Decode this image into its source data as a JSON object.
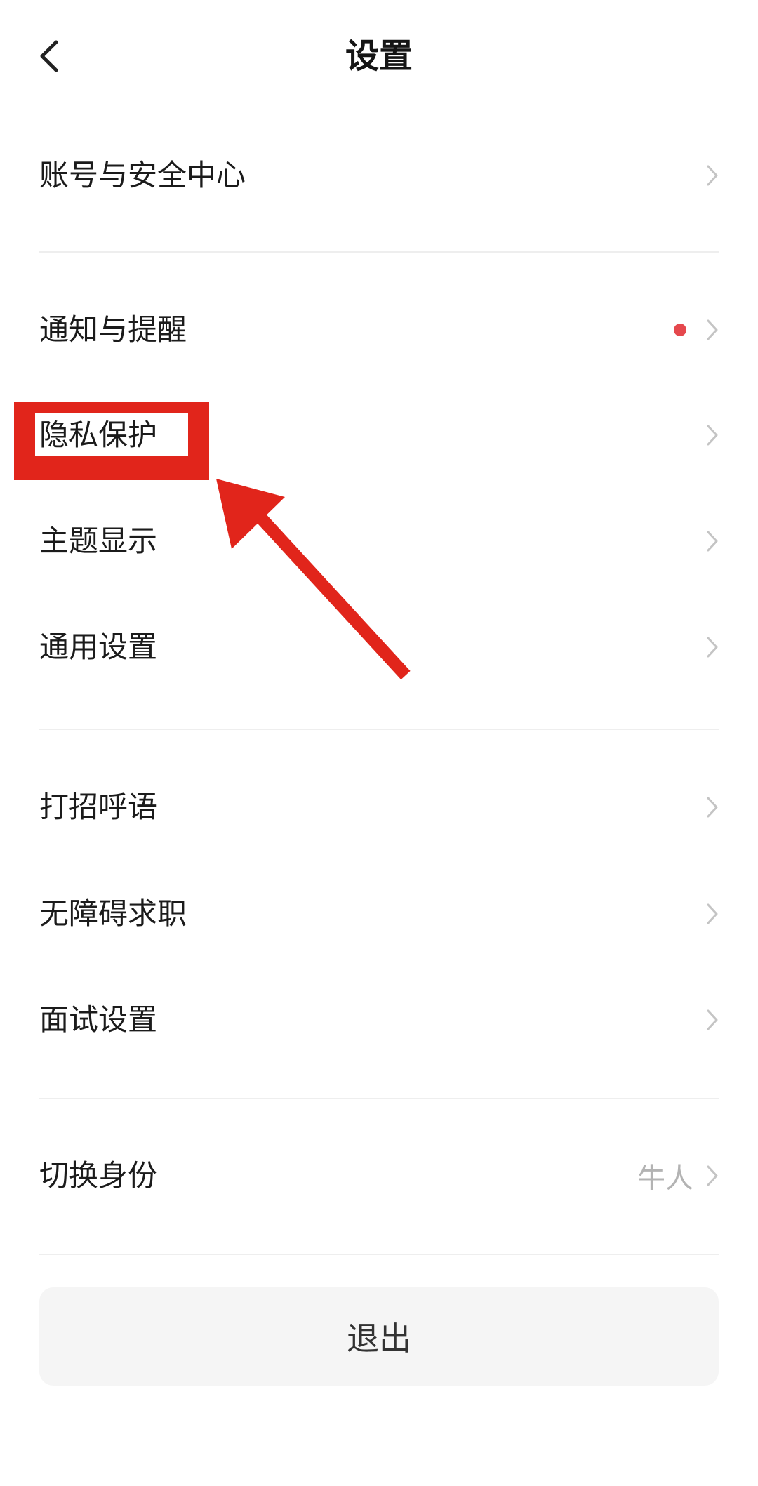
{
  "header": {
    "title": "设置",
    "back_icon": "chevron-left-icon"
  },
  "sections": [
    {
      "items": [
        {
          "label": "账号与安全中心",
          "badge": false,
          "value": ""
        }
      ]
    },
    {
      "items": [
        {
          "label": "通知与提醒",
          "badge": true,
          "value": ""
        },
        {
          "label": "隐私保护",
          "badge": false,
          "value": ""
        },
        {
          "label": "主题显示",
          "badge": false,
          "value": ""
        },
        {
          "label": "通用设置",
          "badge": false,
          "value": ""
        }
      ]
    },
    {
      "items": [
        {
          "label": "打招呼语",
          "badge": false,
          "value": ""
        },
        {
          "label": "无障碍求职",
          "badge": false,
          "value": ""
        },
        {
          "label": "面试设置",
          "badge": false,
          "value": ""
        }
      ]
    },
    {
      "items": [
        {
          "label": "切换身份",
          "badge": false,
          "value": "牛人"
        }
      ]
    }
  ],
  "logout_label": "退出",
  "colors": {
    "badge": "#e5484d",
    "annotation": "#e1251b",
    "chevron": "#c4c4c4",
    "logout_bg": "#f5f5f5"
  }
}
